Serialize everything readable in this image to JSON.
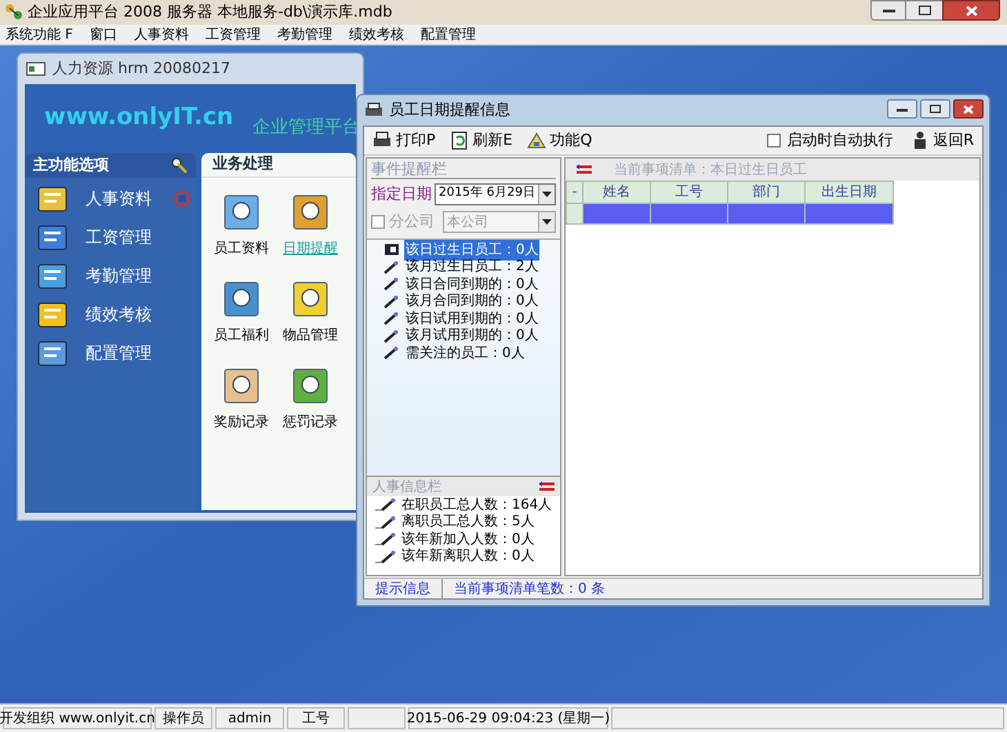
{
  "window": {
    "title": "企业应用平台 2008 服务器 本地服务-db\\演示库.mdb"
  },
  "menu": [
    "系统功能 F",
    "窗口",
    "人事资料",
    "工资管理",
    "考勤管理",
    "绩效考核",
    "配置管理"
  ],
  "hrm_window": {
    "title": "人力资源 hrm 20080217",
    "logo": "www.onlyIT.cn",
    "slogan": "企业管理平台",
    "sidebar": {
      "title": "主功能选项",
      "items": [
        {
          "label": "人事资料",
          "selected": true
        },
        {
          "label": "工资管理",
          "selected": false
        },
        {
          "label": "考勤管理",
          "selected": false
        },
        {
          "label": "绩效考核",
          "selected": false
        },
        {
          "label": "配置管理",
          "selected": false
        }
      ]
    },
    "panel": {
      "title": "业务处理",
      "tiles": [
        {
          "label": "员工资料",
          "selected": false
        },
        {
          "label": "日期提醒",
          "selected": true
        },
        {
          "label": "员工福利",
          "selected": false
        },
        {
          "label": "物品管理",
          "selected": false
        },
        {
          "label": "奖励记录",
          "selected": false
        },
        {
          "label": "惩罚记录",
          "selected": false
        }
      ]
    }
  },
  "dialog": {
    "title": "员工日期提醒信息",
    "toolbar": [
      {
        "label": "打印P",
        "kind": "print"
      },
      {
        "label": "刷新E",
        "kind": "refresh"
      },
      {
        "label": "功能Q",
        "kind": "function"
      }
    ],
    "autorun": {
      "label": "启动时自动执行",
      "checked": false
    },
    "back": "返回R",
    "events": {
      "title": "事件提醒栏",
      "date_label": "指定日期",
      "date_value": "2015年 6月29日",
      "branch": {
        "label": "分公司",
        "checked": false,
        "disabled": true,
        "value": "本公司"
      },
      "items": [
        {
          "label": "该日过生日员工：0人",
          "selected": true
        },
        {
          "label": "该月过生日员工：2人",
          "selected": false
        },
        {
          "label": "该日合同到期的：0人",
          "selected": false
        },
        {
          "label": "该月合同到期的：0人",
          "selected": false
        },
        {
          "label": "该日试用到期的：0人",
          "selected": false
        },
        {
          "label": "该月试用到期的：0人",
          "selected": false
        },
        {
          "label": "需关注的员工：0人",
          "selected": false
        }
      ]
    },
    "hr_info": {
      "title": "人事信息栏",
      "items": [
        "在职员工总人数：164人",
        "离职员工总人数：5人",
        "该年新加入人数：0人",
        "该年新离职人数：0人"
      ]
    },
    "list": {
      "caption": "当前事项清单：本日过生日员工",
      "marker": "-",
      "columns": [
        "姓名",
        "工号",
        "部门",
        "出生日期"
      ],
      "rows": [
        {
          "selected": true,
          "cells": [
            "",
            "",
            "",
            ""
          ]
        }
      ]
    },
    "status": [
      "提示信息",
      "当前事项清单笔数：0 条"
    ]
  },
  "status_bar": [
    "开发组织 www.onlyit.cn",
    "操作员",
    "admin",
    "工号",
    "2015-06-29 09:04:23  (星期一)"
  ]
}
